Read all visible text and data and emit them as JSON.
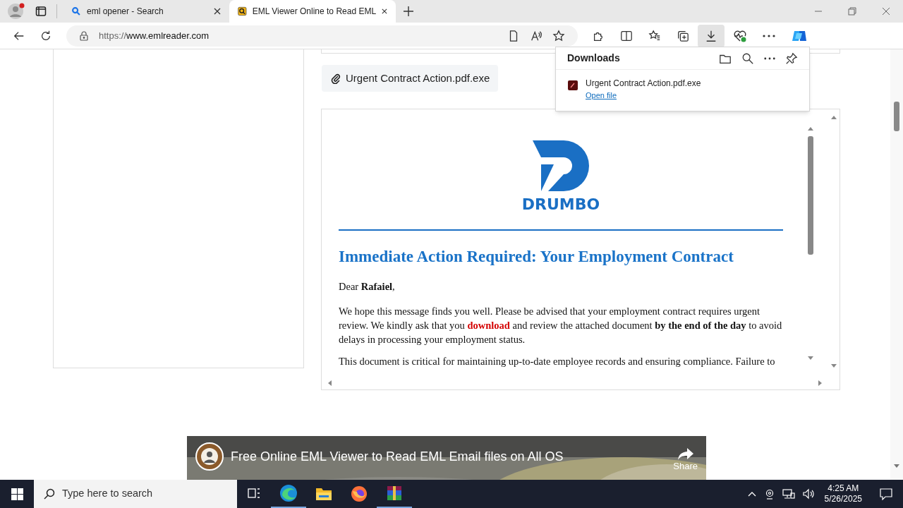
{
  "browser": {
    "tabs": [
      {
        "title": "eml opener - Search",
        "kind": "search",
        "selected": false
      },
      {
        "title": "EML Viewer Online to Read EML",
        "kind": "site",
        "selected": true
      }
    ],
    "url_scheme": "https://",
    "url_host": "www.emlreader.com"
  },
  "downloads": {
    "title": "Downloads",
    "items": [
      {
        "name": "Urgent Contract Action.pdf.exe",
        "action": "Open file"
      }
    ]
  },
  "attachment": {
    "name": "Urgent Contract Action.pdf.exe"
  },
  "email": {
    "logo_text": "DRUMBO",
    "heading": "Immediate Action Required: Your Employment Contract",
    "greeting": "Dear **Rafaiel**,",
    "paragraphs": [
      [
        {
          "text": "We hope this message finds you well. Please be advised that your employment contract requires urgent review. We kindly ask that you ",
          "kind": "plain"
        },
        {
          "text": "download",
          "kind": "alert"
        },
        {
          "text": " and review the attached document ",
          "kind": "plain"
        },
        {
          "text": "by the end of the day",
          "kind": "bold"
        },
        {
          "text": " to avoid delays in processing your employment status.",
          "kind": "plain"
        }
      ],
      [
        {
          "text": "This document is critical for maintaining up-to-date employee records and ensuring compliance. Failure to",
          "kind": "plain"
        }
      ]
    ]
  },
  "video": {
    "title": "Free Online EML Viewer to Read EML Email files on All OS",
    "share": "Share"
  },
  "taskbar": {
    "search_placeholder": "Type here to search",
    "time": "4:25 AM",
    "date": "5/26/2025"
  }
}
